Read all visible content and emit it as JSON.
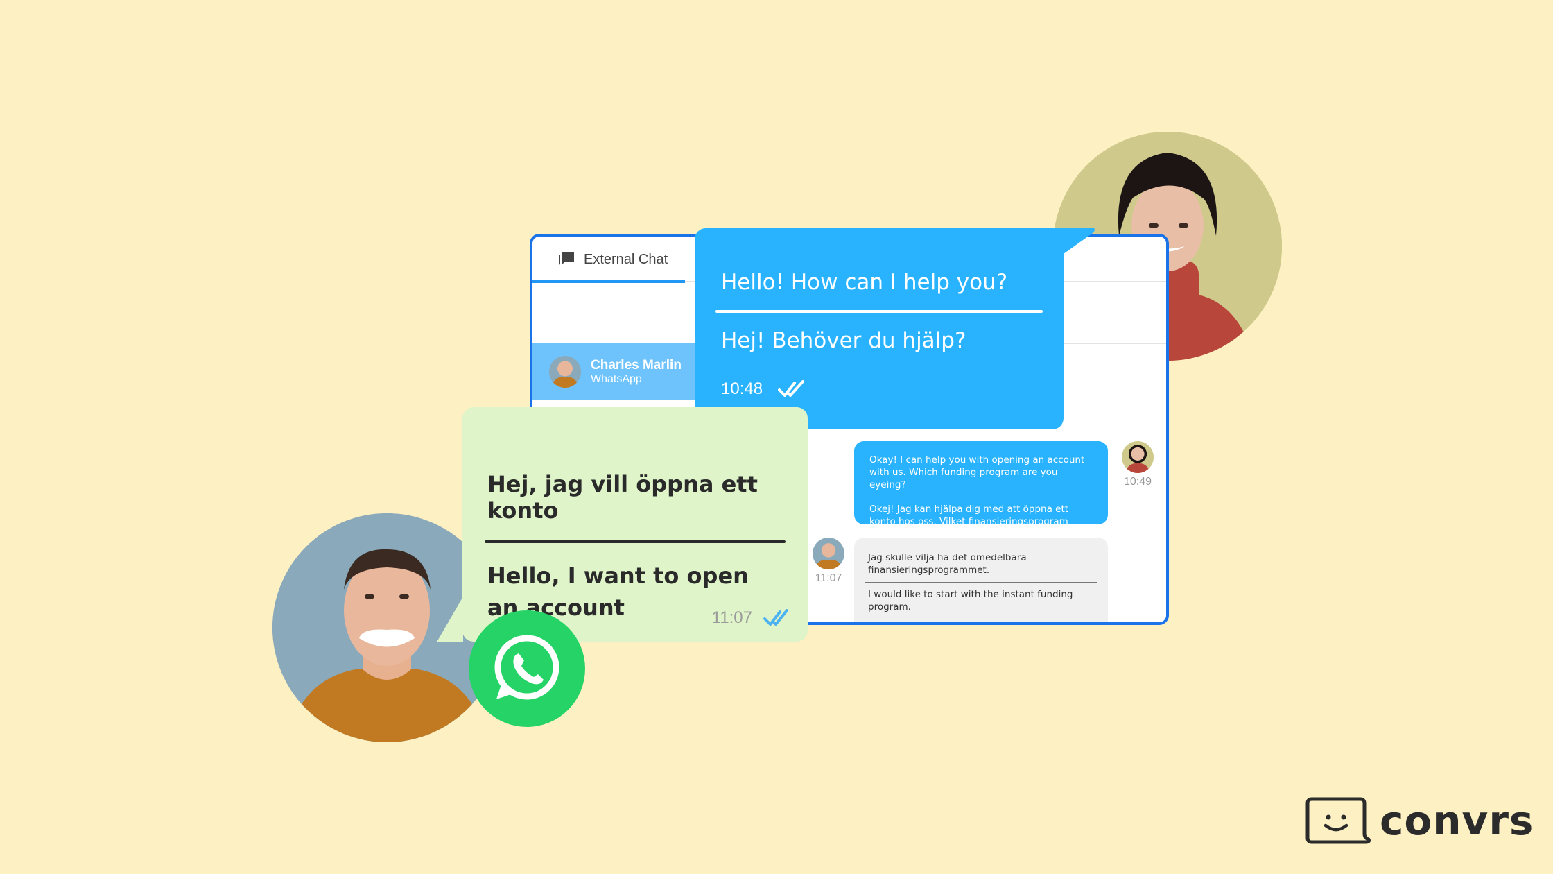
{
  "app": {
    "brand": "convrs",
    "brand_color": "#2b2b2b",
    "background": "#fdf0c2"
  },
  "window": {
    "tab": {
      "label": "External Chat",
      "icon": "chat-bubbles-icon"
    },
    "contact": {
      "name": "Charles Marlin",
      "channel": "WhatsApp"
    },
    "messages": [
      {
        "from": "agent",
        "text_en": "Okay! I can help you with opening an account with us. Which funding program are you eyeing?",
        "text_sv": "Okej! Jag kan hjälpa dig med att öppna ett konto hos oss. Vilket finansieringsprogram tittar du på?",
        "time": "10:49"
      },
      {
        "from": "customer",
        "text_sv": "Jag skulle vilja ha det omedelbara finansieringsprogrammet.",
        "text_en": "I would like to start with the instant funding program.",
        "time": "11:07"
      }
    ]
  },
  "bubble_agent": {
    "line1": "Hello! How can I help you?",
    "line2": "Hej! Behöver du hjälp?",
    "time": "10:48",
    "status_icon": "double-check-icon",
    "color": "#29b3ff"
  },
  "bubble_customer": {
    "line1": "Hej, jag vill öppna ett konto",
    "line2": "Hello, I want to open an account",
    "time": "11:07",
    "status_icon": "double-check-icon",
    "color": "#dff4c9",
    "check_color": "#4db3f0"
  },
  "whatsapp": {
    "icon": "whatsapp-icon",
    "color": "#25d366"
  }
}
